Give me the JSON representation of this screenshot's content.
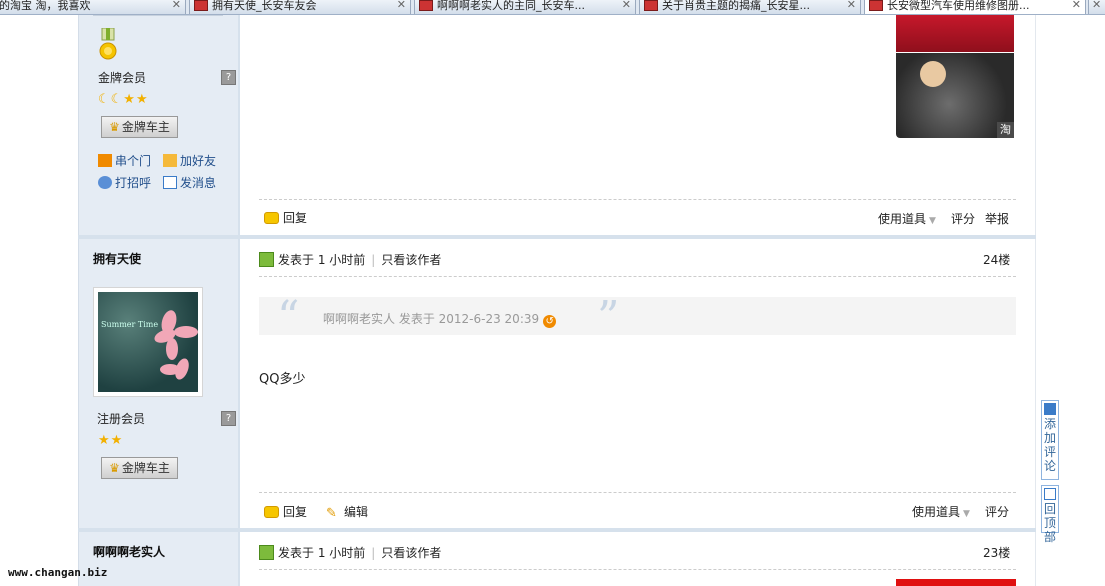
{
  "tabs": [
    {
      "label": "的淘宝 淘，我喜欢",
      "active": false
    },
    {
      "label": "拥有天使_长安车友会",
      "active": false
    },
    {
      "label": "啊啊啊老实人的主同_长安车...",
      "active": false
    },
    {
      "label": "关于肖贵主题的揭痛_长安星...",
      "active": false
    },
    {
      "label": "长安微型汽车使用维修图册...",
      "active": true
    }
  ],
  "post_prev": {
    "rank": "金牌会员",
    "rank_stars": "☾☾★★",
    "badge": "金牌车主",
    "links": {
      "visit": "串个门",
      "add_friend": "加好友",
      "greet": "打招呼",
      "message": "发消息"
    },
    "photo_badge": "淘",
    "reply": "回复",
    "tools": "使用道具",
    "rate": "评分",
    "report": "举报"
  },
  "post_24": {
    "username": "拥有天使",
    "posted": "发表于 1 小时前",
    "only_author": "只看该作者",
    "floor": "24楼",
    "avatar_text": "Summer Time",
    "quote": {
      "author": "啊啊啊老实人 发表于 2012-6-23 20:39"
    },
    "message": "QQ多少",
    "rank": "注册会员",
    "rank_stars": "★★",
    "badge": "金牌车主",
    "reply": "回复",
    "edit": "编辑",
    "tools": "使用道具",
    "rate": "评分"
  },
  "post_23": {
    "username": "啊啊啊老实人",
    "posted": "发表于 1 小时前",
    "only_author": "只看该作者",
    "floor": "23楼"
  },
  "side_buttons": {
    "add_comment": "添加评论",
    "back_to_top": "回顶部"
  },
  "watermark": "www.changan.biz"
}
